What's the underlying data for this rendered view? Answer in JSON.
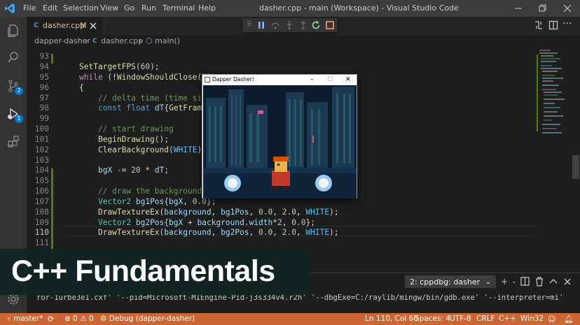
{
  "titlebar": {
    "menu": [
      "File",
      "Edit",
      "Selection",
      "View",
      "Go",
      "Run",
      "Terminal",
      "Help"
    ],
    "window_title": "dasher.cpp - main (Workspace) - Visual Studio Code"
  },
  "activity_bar": {
    "source_control_badge": "2",
    "run_debug_badge": "1"
  },
  "tab": {
    "filename": "dasher.cpp",
    "modified_marker": "M"
  },
  "breadcrumb": {
    "folder": "dapper-dasher",
    "file": "dasher.cpp",
    "symbol": "main()"
  },
  "editor": {
    "line_numbers": [
      "93",
      "94",
      "95",
      "96",
      "97",
      "98",
      "99",
      "100",
      "101",
      "102",
      "103",
      "104",
      "105",
      "106",
      "107",
      "108",
      "109",
      "110",
      "111"
    ],
    "current_line": "110"
  },
  "game_window": {
    "title": "Dapper Dasher!"
  },
  "panel": {
    "terminal_selected": "2: cppdbg: dasher",
    "terminal_output": "ror-1urbe3e1.cxf' '--pid=Microsoft-MIEngine-Pid-j3s334v4.r2h' '--dbgExe=C:/raylib/mingw/bin/gdb.exe' '--interpreter=mi'"
  },
  "banner": {
    "title": "C++ Fundamentals"
  },
  "statusbar": {
    "branch": "master*",
    "errors": "0",
    "warnings": "0",
    "debug_config": "Debug (dapper-dasher)",
    "cursor_position": "Ln 110, Col 60",
    "indentation": "Spaces: 4",
    "encoding": "UTF-8",
    "eol": "CRLF",
    "language": "C++",
    "platform": "Win32"
  },
  "colors": {
    "statusbar_debug": "#cc6633",
    "accent": "#007acc",
    "titlebar": "#3c3c3c",
    "editor_bg": "#1e1e1e"
  }
}
